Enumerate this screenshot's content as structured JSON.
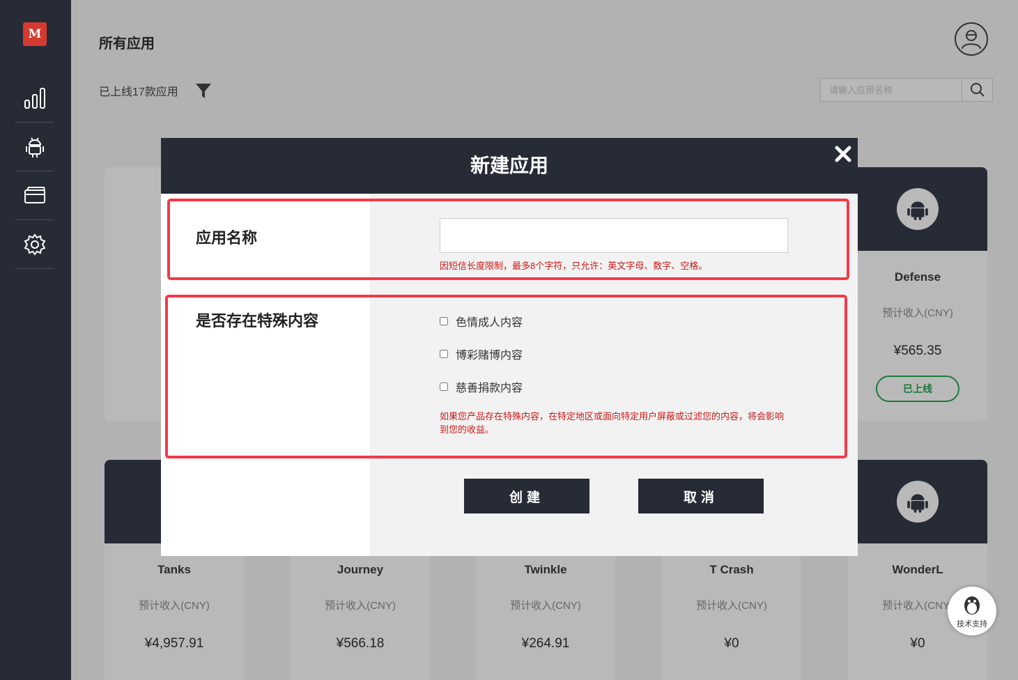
{
  "sidebar": {
    "logo_text": "M",
    "items": [
      {
        "name": "analytics"
      },
      {
        "name": "android"
      },
      {
        "name": "payment"
      },
      {
        "name": "settings"
      }
    ]
  },
  "header": {
    "title": "所有应用",
    "online_count": "已上线17款应用",
    "search_placeholder": "请输入应用名称"
  },
  "cards_row1_right": {
    "name": "Defense",
    "revenue_label": "预计收入(CNY)",
    "revenue": "¥565.35",
    "status": "已上线"
  },
  "cards_row2": [
    {
      "name": "Tanks",
      "revenue_label": "预计收入(CNY)",
      "revenue": "¥4,957.91"
    },
    {
      "name": "Journey",
      "revenue_label": "预计收入(CNY)",
      "revenue": "¥566.18"
    },
    {
      "name": "Twinkle",
      "revenue_label": "预计收入(CNY)",
      "revenue": "¥264.91"
    },
    {
      "name": "T Crash",
      "revenue_label": "预计收入(CNY)",
      "revenue": "¥0"
    },
    {
      "name": "WonderL",
      "revenue_label": "预计收入(CNY)",
      "revenue": "¥0"
    }
  ],
  "modal": {
    "title": "新建应用",
    "name_label": "应用名称",
    "name_value": "",
    "name_hint": "因短信长度限制，最多8个字符，只允许：英文字母、数字、空格。",
    "special_label": "是否存在特殊内容",
    "options": [
      "色情成人内容",
      "博彩赌博内容",
      "慈善捐款内容"
    ],
    "special_hint": "如果您产品存在特殊内容，在特定地区或面向特定用户屏蔽或过滤您的内容，将会影响到您的收益。",
    "create_label": "创建",
    "cancel_label": "取消"
  },
  "support": {
    "label": "技术支持"
  },
  "colors": {
    "dark": "#262b36",
    "accent_red": "#f23a4a",
    "hint_red": "#d01818",
    "online_green": "#1a7a3a"
  }
}
